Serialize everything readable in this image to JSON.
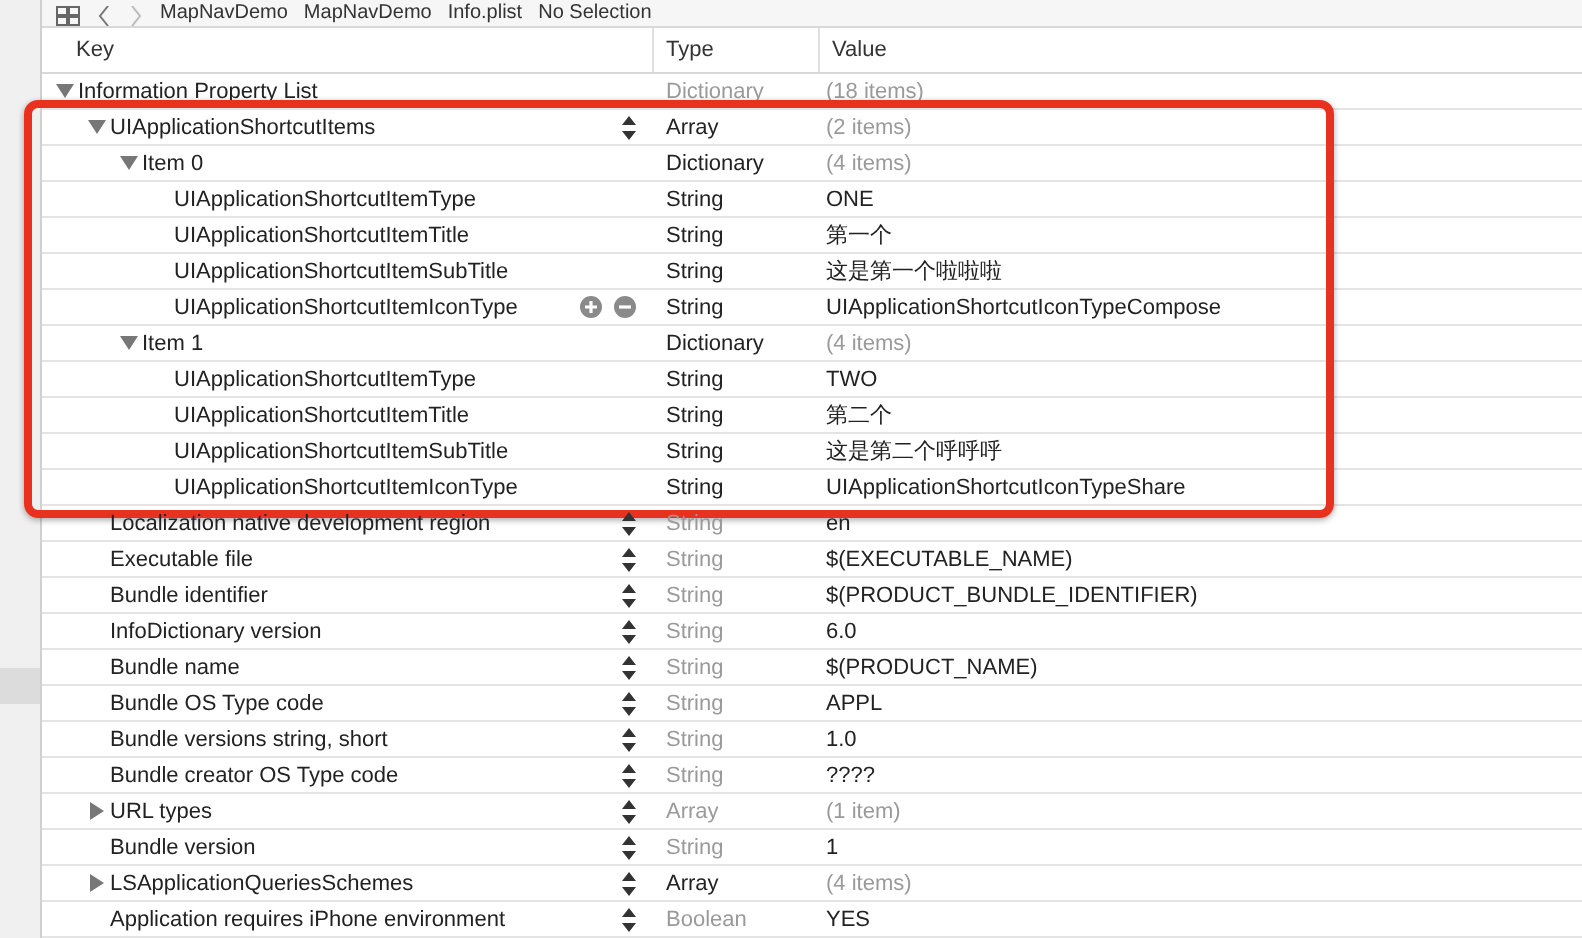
{
  "breadcrumb": [
    "MapNavDemo",
    "MapNavDemo",
    "Info.plist",
    "No Selection"
  ],
  "columns": [
    "Key",
    "Type",
    "Value"
  ],
  "root": {
    "key": "Information Property List",
    "type": "Dictionary",
    "value": "(18 items)",
    "type_dimmed": true,
    "value_dimmed": true,
    "stepper": false,
    "expanded": true,
    "children": [
      {
        "key": "UIApplicationShortcutItems",
        "type": "Array",
        "value": "(2 items)",
        "type_dimmed": false,
        "value_dimmed": true,
        "stepper": true,
        "highlighted": true,
        "expanded": true,
        "children": [
          {
            "key": "Item 0",
            "type": "Dictionary",
            "value": "(4 items)",
            "type_dimmed": false,
            "value_dimmed": true,
            "stepper": false,
            "expanded": true,
            "children": [
              {
                "key": "UIApplicationShortcutItemType",
                "type": "String",
                "value": "ONE",
                "type_dimmed": false,
                "value_dimmed": false,
                "stepper": false
              },
              {
                "key": "UIApplicationShortcutItemTitle",
                "type": "String",
                "value": "第一个",
                "type_dimmed": false,
                "value_dimmed": false,
                "stepper": false
              },
              {
                "key": "UIApplicationShortcutItemSubTitle",
                "type": "String",
                "value": "这是第一个啦啦啦",
                "type_dimmed": false,
                "value_dimmed": false,
                "stepper": false
              },
              {
                "key": "UIApplicationShortcutItemIconType",
                "type": "String",
                "value": "UIApplicationShortcutIconTypeCompose",
                "type_dimmed": false,
                "value_dimmed": false,
                "stepper": false,
                "add_remove": true
              }
            ]
          },
          {
            "key": "Item 1",
            "type": "Dictionary",
            "value": "(4 items)",
            "type_dimmed": false,
            "value_dimmed": true,
            "stepper": false,
            "expanded": true,
            "children": [
              {
                "key": "UIApplicationShortcutItemType",
                "type": "String",
                "value": "TWO",
                "type_dimmed": false,
                "value_dimmed": false,
                "stepper": false
              },
              {
                "key": "UIApplicationShortcutItemTitle",
                "type": "String",
                "value": "第二个",
                "type_dimmed": false,
                "value_dimmed": false,
                "stepper": false
              },
              {
                "key": "UIApplicationShortcutItemSubTitle",
                "type": "String",
                "value": "这是第二个呼呼呼",
                "type_dimmed": false,
                "value_dimmed": false,
                "stepper": false
              },
              {
                "key": "UIApplicationShortcutItemIconType",
                "type": "String",
                "value": "UIApplicationShortcutIconTypeShare",
                "type_dimmed": false,
                "value_dimmed": false,
                "stepper": false
              }
            ]
          }
        ]
      },
      {
        "key": "Localization native development region",
        "type": "String",
        "value": "en",
        "type_dimmed": true,
        "value_dimmed": false,
        "stepper": true
      },
      {
        "key": "Executable file",
        "type": "String",
        "value": "$(EXECUTABLE_NAME)",
        "type_dimmed": true,
        "value_dimmed": false,
        "stepper": true
      },
      {
        "key": "Bundle identifier",
        "type": "String",
        "value": "$(PRODUCT_BUNDLE_IDENTIFIER)",
        "type_dimmed": true,
        "value_dimmed": false,
        "stepper": true
      },
      {
        "key": "InfoDictionary version",
        "type": "String",
        "value": "6.0",
        "type_dimmed": true,
        "value_dimmed": false,
        "stepper": true
      },
      {
        "key": "Bundle name",
        "type": "String",
        "value": "$(PRODUCT_NAME)",
        "type_dimmed": true,
        "value_dimmed": false,
        "stepper": true
      },
      {
        "key": "Bundle OS Type code",
        "type": "String",
        "value": "APPL",
        "type_dimmed": true,
        "value_dimmed": false,
        "stepper": true
      },
      {
        "key": "Bundle versions string, short",
        "type": "String",
        "value": "1.0",
        "type_dimmed": true,
        "value_dimmed": false,
        "stepper": true
      },
      {
        "key": "Bundle creator OS Type code",
        "type": "String",
        "value": "????",
        "type_dimmed": true,
        "value_dimmed": false,
        "stepper": true
      },
      {
        "key": "URL types",
        "type": "Array",
        "value": "(1 item)",
        "type_dimmed": true,
        "value_dimmed": true,
        "stepper": true,
        "expanded": false
      },
      {
        "key": "Bundle version",
        "type": "String",
        "value": "1",
        "type_dimmed": true,
        "value_dimmed": false,
        "stepper": true
      },
      {
        "key": "LSApplicationQueriesSchemes",
        "type": "Array",
        "value": "(4 items)",
        "type_dimmed": false,
        "value_dimmed": true,
        "stepper": true,
        "expanded": false
      },
      {
        "key": "Application requires iPhone environment",
        "type": "Boolean",
        "value": "YES",
        "type_dimmed": true,
        "value_dimmed": false,
        "stepper": true
      }
    ]
  }
}
